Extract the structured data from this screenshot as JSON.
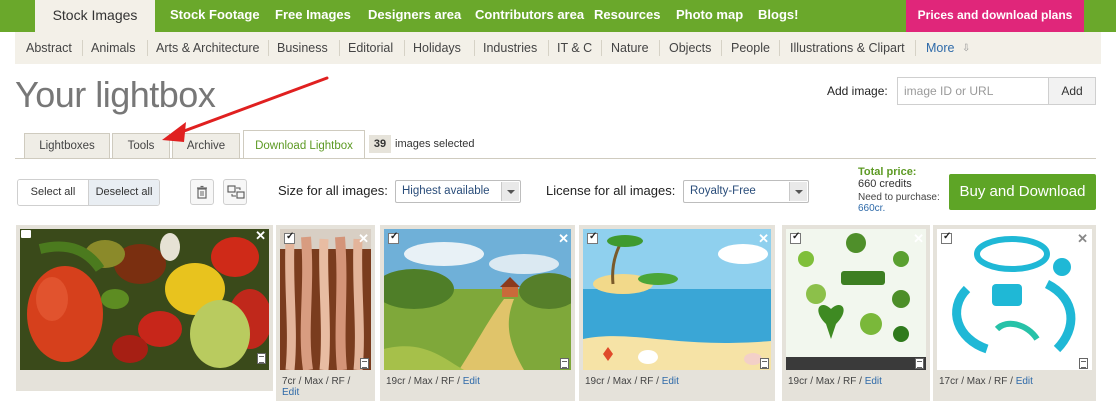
{
  "topnav": {
    "tabs": [
      "Stock Images",
      "Stock Footage",
      "Free Images",
      "Designers area",
      "Contributors area",
      "Resources",
      "Photo map",
      "Blogs!"
    ],
    "prices": "Prices and download plans"
  },
  "subnav": {
    "categories": [
      "Abstract",
      "Animals",
      "Arts & Architecture",
      "Business",
      "Editorial",
      "Holidays",
      "Industries",
      "IT & C",
      "Nature",
      "Objects",
      "People",
      "Illustrations & Clipart"
    ],
    "more": "More"
  },
  "page": {
    "title": "Your lightbox"
  },
  "add_image": {
    "label": "Add image:",
    "placeholder": "image ID or URL",
    "button": "Add"
  },
  "lightbox_tabs": {
    "tabs": [
      "Lightboxes",
      "Tools",
      "Archive",
      "Download Lightbox"
    ],
    "active": "Download Lightbox",
    "selected_count": "39",
    "selected_text": "images selected"
  },
  "toolbar": {
    "select_all": "Select all",
    "deselect_all": "Deselect all",
    "size_label": "Size for all images:",
    "size_value": "Highest available",
    "license_label": "License for all images:",
    "license_value": "Royalty-Free"
  },
  "pricing": {
    "total_label": "Total price:",
    "total_value": "660 credits",
    "need_label": "Need to purchase:",
    "need_value": "660cr.",
    "buy_button": "Buy and Download"
  },
  "images": [
    {
      "subject": "vegetables",
      "caption": "",
      "edit": ""
    },
    {
      "subject": "hanging octopus tentacles",
      "caption": "7cr / Max / RF /",
      "edit": "Edit"
    },
    {
      "subject": "painted countryside road",
      "caption": "19cr / Max / RF /",
      "edit": "Edit"
    },
    {
      "subject": "tropical beach island",
      "caption": "19cr / Max / RF /",
      "edit": "Edit"
    },
    {
      "subject": "eco icons organic",
      "caption": "19cr / Max / RF /",
      "edit": "Edit"
    },
    {
      "subject": "cyan music illustration",
      "caption": "17cr / Max / RF /",
      "edit": "Edit"
    }
  ],
  "colors": {
    "brand_green": "#6aa82b",
    "accent_pink": "#e0267a",
    "buy_green": "#5ea526",
    "annotation_arrow": "#e02020"
  }
}
